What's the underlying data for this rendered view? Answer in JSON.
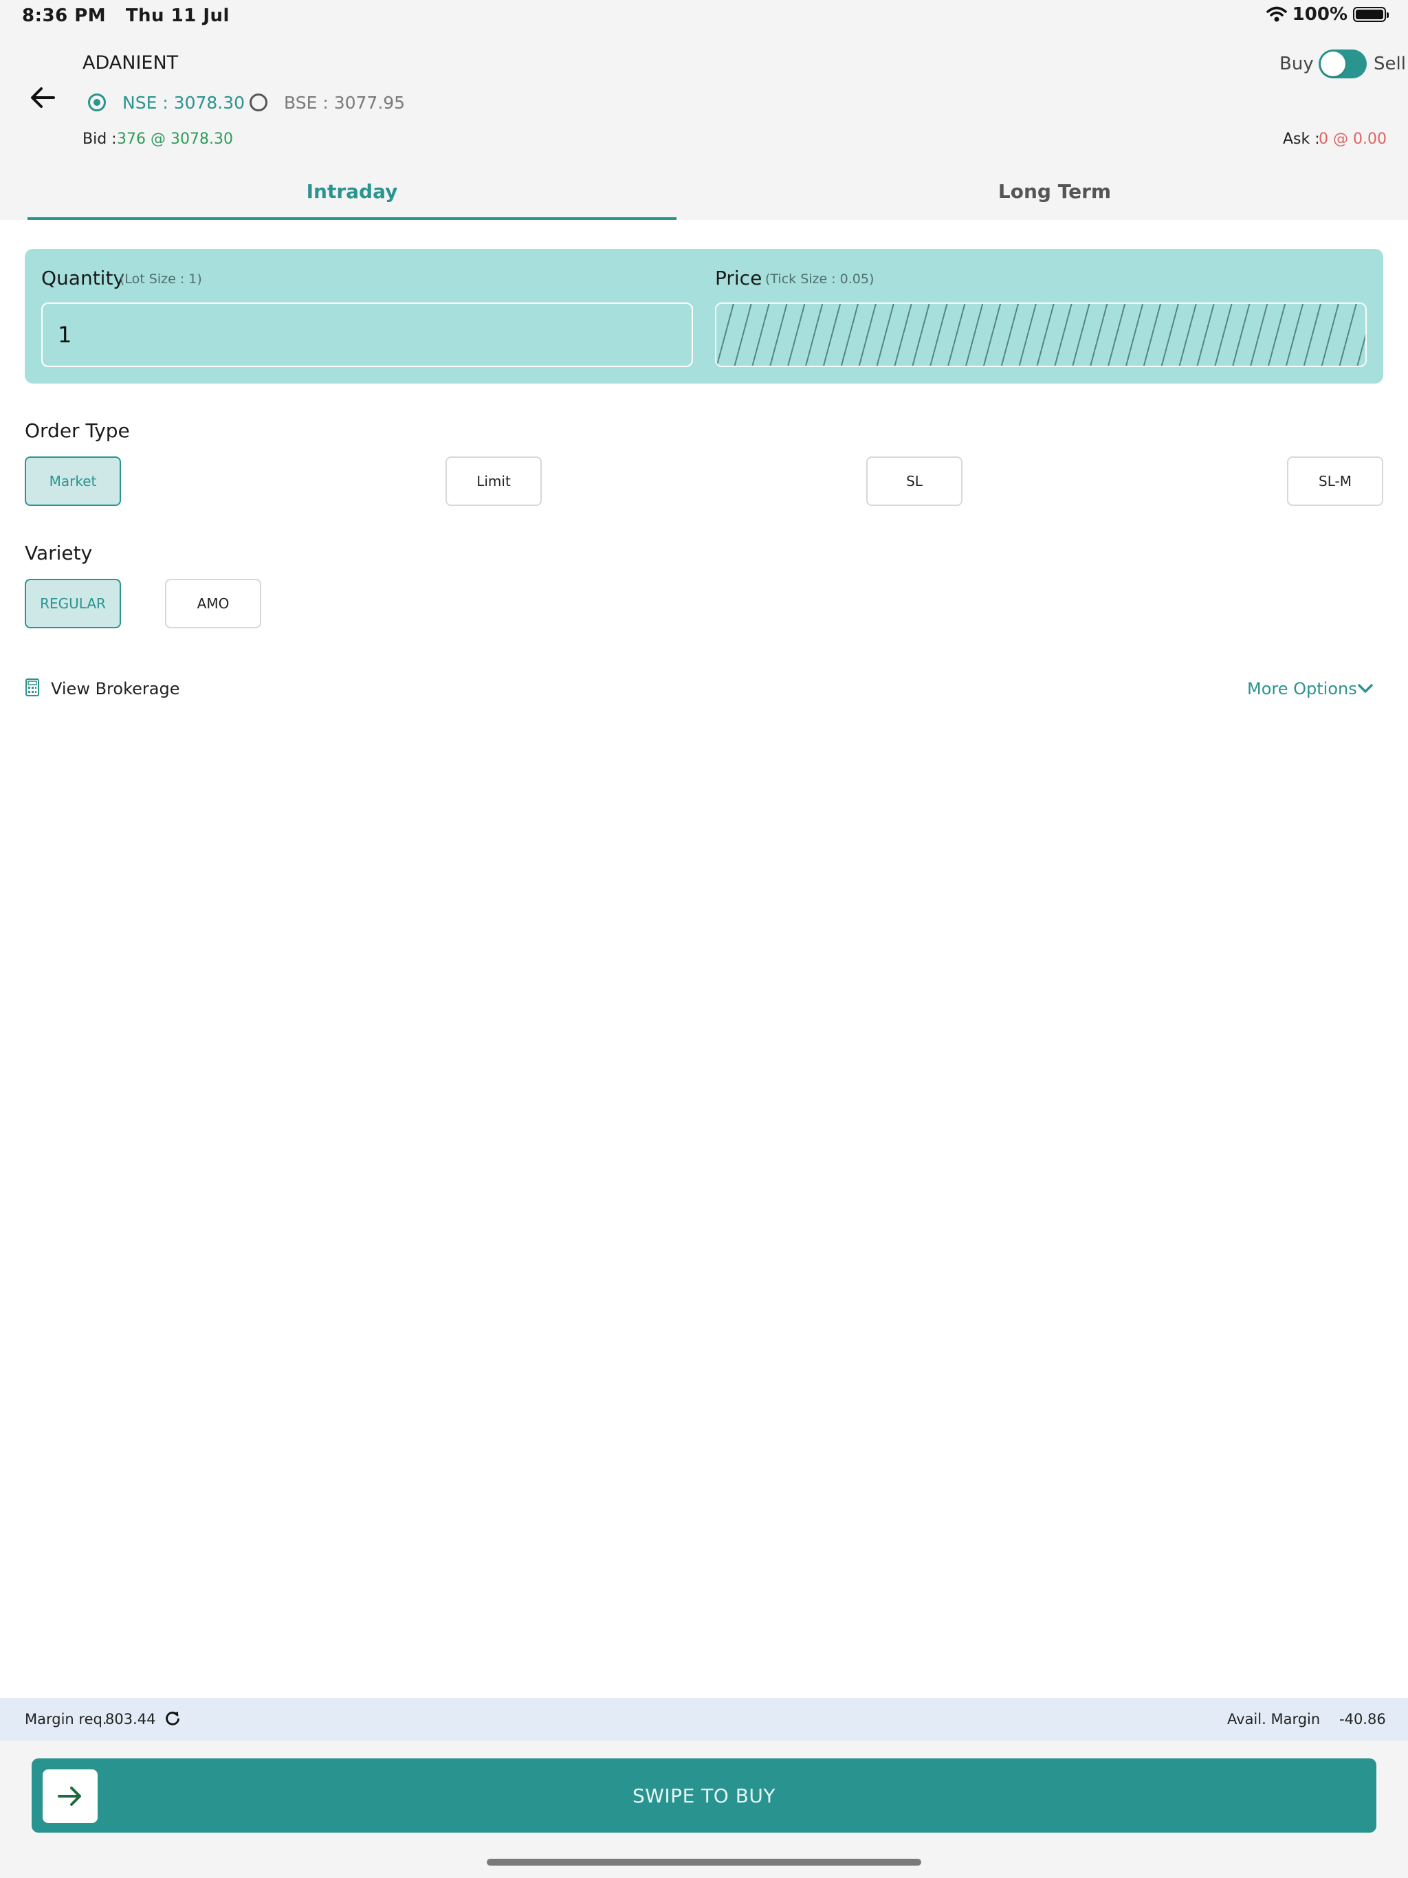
{
  "status_bar": {
    "time": "8:36 PM",
    "date": "Thu 11 Jul",
    "battery": "100%"
  },
  "header": {
    "symbol": "ADANIENT",
    "exchanges": [
      {
        "label": "NSE :  3078.30",
        "selected": true
      },
      {
        "label": "BSE :  3077.95",
        "selected": false
      }
    ],
    "bid_label": "Bid :",
    "bid_value": "376 @ 3078.30",
    "ask_label": "Ask :",
    "ask_value": "0 @ 0.00",
    "buy_label": "Buy",
    "sell_label": "Sell"
  },
  "tabs": [
    {
      "label": "Intraday",
      "active": true
    },
    {
      "label": "Long Term",
      "active": false
    }
  ],
  "form": {
    "quantity_label": "Quantity",
    "quantity_hint": "(Lot Size : 1)",
    "quantity_value": "1",
    "price_label": "Price",
    "price_hint": "(Tick Size : 0.05)"
  },
  "order_type": {
    "title": "Order Type",
    "options": [
      "Market",
      "Limit",
      "SL",
      "SL-M"
    ],
    "selected": "Market"
  },
  "variety": {
    "title": "Variety",
    "options": [
      "REGULAR",
      "AMO"
    ],
    "selected": "REGULAR"
  },
  "links": {
    "view_brokerage": "View Brokerage",
    "more_options": "More Options"
  },
  "footer": {
    "margin_req_label": "Margin req.",
    "margin_req_value": "803.44",
    "avail_margin_label": "Avail. Margin",
    "avail_margin_value": "-40.86",
    "swipe_label": "SWIPE TO BUY"
  },
  "colors": {
    "accent": "#2a948f",
    "card_bg": "#a6dfdc",
    "bid": "#2e9c5a",
    "ask": "#e06363",
    "margin_bar": "#e2ebf6"
  },
  "icons": [
    "wifi-icon",
    "battery-icon",
    "back-arrow-icon",
    "calculator-icon",
    "chevron-down-icon",
    "refresh-icon",
    "arrow-right-icon"
  ]
}
